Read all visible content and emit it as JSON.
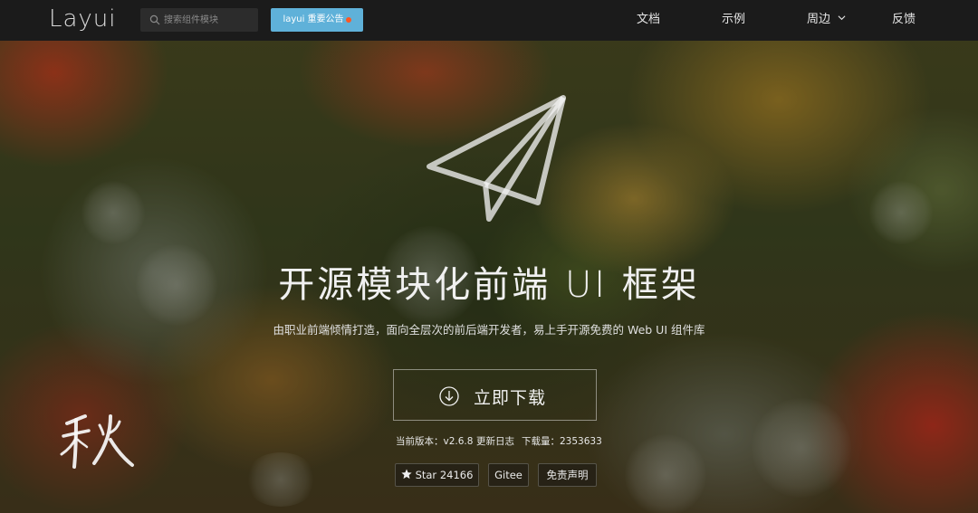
{
  "header": {
    "logo": "Layui",
    "search_placeholder": "搜索组件模块",
    "notice_label": "layui 重要公告",
    "nav": [
      {
        "label": "文档"
      },
      {
        "label": "示例"
      },
      {
        "label": "周边"
      },
      {
        "label": "反馈"
      }
    ]
  },
  "hero": {
    "title": "开源模块化前端 UI 框架",
    "subtitle": "由职业前端倾情打造，面向全层次的前后端开发者，易上手开源免费的 Web UI 组件库",
    "download_label": "立即下载",
    "version_label": "当前版本：",
    "version": "v2.6.8",
    "changelog_label": "更新日志",
    "downloads_label": "下载量：",
    "downloads": "2353633"
  },
  "badges": {
    "star_label": "Star 24166",
    "gitee_label": "Gitee",
    "disclaimer_label": "免责声明"
  },
  "calligraphy": "秋",
  "colors": {
    "header_bg": "#1b1b1b",
    "notice_bg": "#5fb1d9",
    "notice_dot": "#ff5722"
  }
}
